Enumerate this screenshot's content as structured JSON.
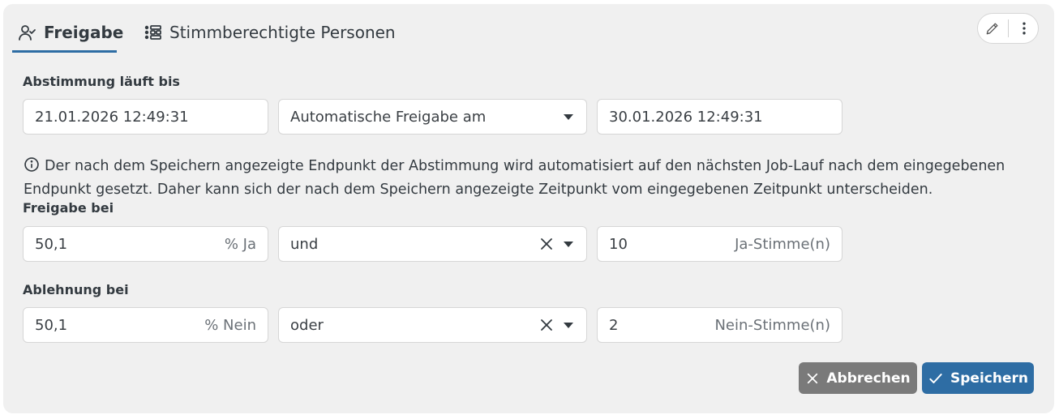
{
  "tabs": [
    {
      "label": "Freigabe",
      "icon": "user-check-icon",
      "active": true
    },
    {
      "label": "Stimmberechtigte Personen",
      "icon": "list-icon",
      "active": false
    }
  ],
  "header_actions": {
    "edit_icon": "pencil-icon",
    "more_icon": "vertical-dots-icon"
  },
  "voting_end": {
    "label": "Abstimmung läuft bis",
    "date_value": "21.01.2026 12:49:31",
    "mode_select": "Automatische Freigabe am",
    "release_date_value": "30.01.2026 12:49:31"
  },
  "info_text": "Der nach dem Speichern angezeigte Endpunkt der Abstimmung wird automatisiert auf den nächsten Job-Lauf nach dem eingegebenen Endpunkt gesetzt. Daher kann sich der nach dem Speichern angezeigte Zeitpunkt vom eingegebenen Zeitpunkt unterscheiden.",
  "approval": {
    "label": "Freigabe bei",
    "percent_value": "50,1",
    "percent_suffix": "% Ja",
    "operator": "und",
    "votes_value": "10",
    "votes_suffix": "Ja-Stimme(n)"
  },
  "rejection": {
    "label": "Ablehnung bei",
    "percent_value": "50,1",
    "percent_suffix": "% Nein",
    "operator": "oder",
    "votes_value": "2",
    "votes_suffix": "Nein-Stimme(n)"
  },
  "buttons": {
    "cancel": "Abbrechen",
    "save": "Speichern"
  },
  "colors": {
    "primary": "#2e6da4",
    "secondary": "#7a7a7a",
    "panel_bg": "#f0f0f0"
  }
}
